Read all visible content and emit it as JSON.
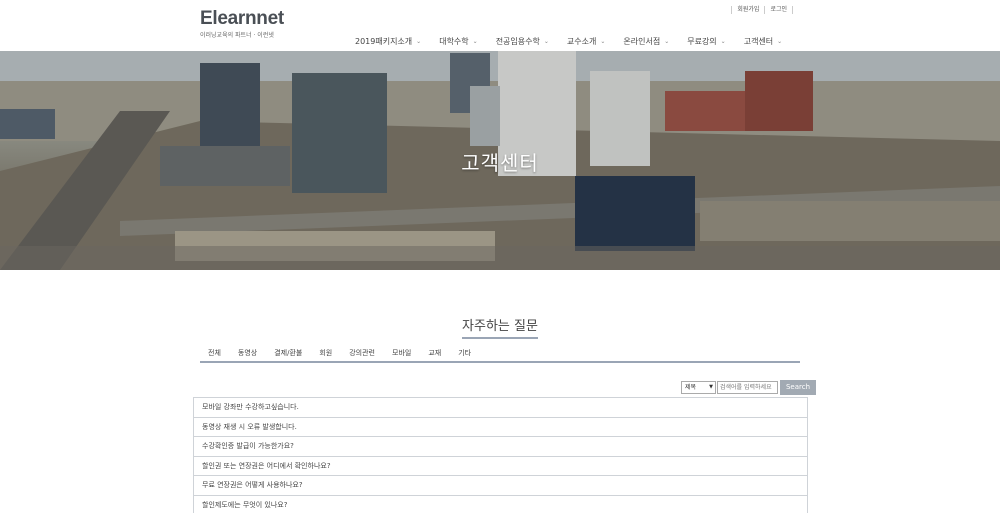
{
  "header": {
    "logo": "Elearnnet",
    "logo_sub": "이러닝교육의 파트너 · 이런넷",
    "util": [
      "회원가입",
      "로그인"
    ]
  },
  "nav": [
    {
      "label": "2019패키지소개"
    },
    {
      "label": "대학수학"
    },
    {
      "label": "전공임용수학"
    },
    {
      "label": "교수소개"
    },
    {
      "label": "온라인서점"
    },
    {
      "label": "무료강의"
    },
    {
      "label": "고객센터"
    }
  ],
  "hero": {
    "title": "고객센터"
  },
  "faq": {
    "title": "자주하는 질문",
    "categories": [
      "전체",
      "동영상",
      "결제/환불",
      "회원",
      "강의관련",
      "모바일",
      "교재",
      "기타"
    ],
    "search": {
      "select_value": "제목",
      "placeholder": "검색어를 입력하세요",
      "button": "Search"
    },
    "items": [
      "모바일 강좌만 수강하고싶습니다.",
      "동영상 재생 시 오류 발생합니다.",
      "수강확인증 발급이 가능한가요?",
      "할인권 또는 연장권은 어디에서 확인하나요?",
      "무료 연장권은 어떻게 사용하나요?",
      "할인제도에는 무엇이 있나요?"
    ]
  },
  "colors": {
    "accent": "#9aa5b5",
    "button": "#a2aab3"
  },
  "icons": [
    "chevron-down-icon"
  ]
}
